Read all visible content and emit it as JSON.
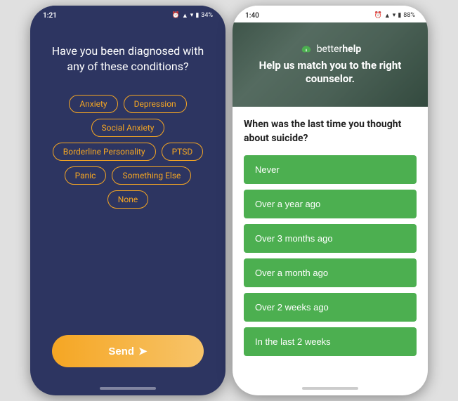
{
  "left_phone": {
    "status_time": "1:21",
    "status_icons": "▲ ⬛ ♦ ▷ ▢",
    "battery": "34%",
    "question": "Have you been diagnosed with any of these conditions?",
    "tags": [
      "Anxiety",
      "Depression",
      "Social Anxiety",
      "Borderline Personality",
      "PTSD",
      "Panic",
      "Something Else",
      "None"
    ],
    "send_button": "Send"
  },
  "right_phone": {
    "status_time": "1:40",
    "battery": "88%",
    "brand_name_prefix": "better",
    "brand_name_suffix": "help",
    "tagline": "Help us match you to the right counselor.",
    "question": "When was the last time you thought about suicide?",
    "options": [
      "Never",
      "Over a year ago",
      "Over 3 months ago",
      "Over a month ago",
      "Over 2 weeks ago",
      "In the last 2 weeks"
    ]
  }
}
